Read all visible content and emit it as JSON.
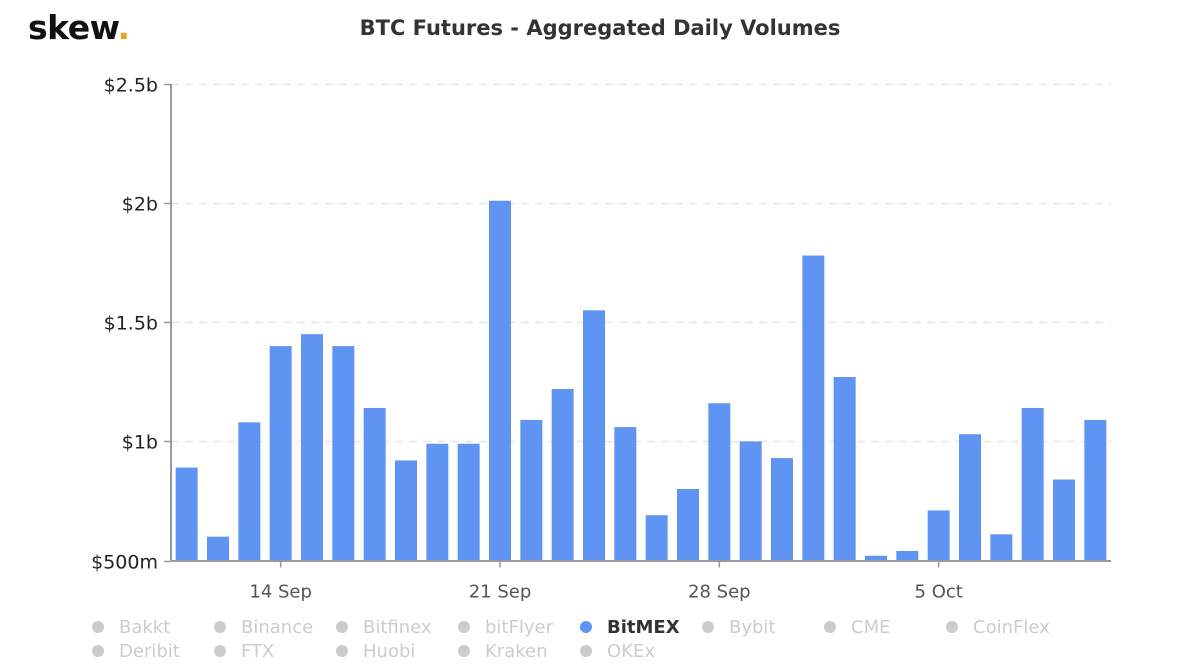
{
  "brand": {
    "name": "skew",
    "dot": ".",
    "dot_color": "#e9a829"
  },
  "chart_data": {
    "type": "bar",
    "title": "BTC Futures - Aggregated Daily Volumes",
    "xlabel": "",
    "ylabel": "",
    "unit": "USD billions",
    "ylim": [
      0.5,
      2.5
    ],
    "yticks": [
      {
        "value": 0.5,
        "label": "$500m"
      },
      {
        "value": 1.0,
        "label": "$1b"
      },
      {
        "value": 1.5,
        "label": "$1.5b"
      },
      {
        "value": 2.0,
        "label": "$2b"
      },
      {
        "value": 2.5,
        "label": "$2.5b"
      }
    ],
    "xticks": [
      {
        "category": "14 Sep",
        "label": "14 Sep"
      },
      {
        "category": "21 Sep",
        "label": "21 Sep"
      },
      {
        "category": "28 Sep",
        "label": "28 Sep"
      },
      {
        "category": "5 Oct",
        "label": "5 Oct"
      }
    ],
    "grid": true,
    "categories": [
      "11 Sep",
      "12 Sep",
      "13 Sep",
      "14 Sep",
      "15 Sep",
      "16 Sep",
      "17 Sep",
      "18 Sep",
      "19 Sep",
      "20 Sep",
      "21 Sep",
      "22 Sep",
      "23 Sep",
      "24 Sep",
      "25 Sep",
      "26 Sep",
      "27 Sep",
      "28 Sep",
      "29 Sep",
      "30 Sep",
      "1 Oct",
      "2 Oct",
      "3 Oct",
      "4 Oct",
      "5 Oct",
      "6 Oct",
      "7 Oct",
      "8 Oct",
      "9 Oct",
      "10 Oct"
    ],
    "series": [
      {
        "name": "BitMEX",
        "color": "#6094f3",
        "values": [
          0.89,
          0.6,
          1.08,
          1.4,
          1.45,
          1.4,
          1.14,
          0.92,
          0.99,
          0.99,
          2.01,
          1.09,
          1.22,
          1.55,
          1.06,
          0.69,
          0.8,
          1.16,
          1.0,
          0.93,
          1.78,
          1.27,
          0.52,
          0.54,
          0.71,
          1.03,
          0.61,
          1.14,
          0.84,
          1.09
        ]
      }
    ],
    "legend": {
      "placement": "bottom",
      "items": [
        {
          "label": "Bakkt",
          "active": false
        },
        {
          "label": "Binance",
          "active": false
        },
        {
          "label": "Bitfinex",
          "active": false
        },
        {
          "label": "bitFlyer",
          "active": false
        },
        {
          "label": "BitMEX",
          "active": true
        },
        {
          "label": "Bybit",
          "active": false
        },
        {
          "label": "CME",
          "active": false
        },
        {
          "label": "CoinFlex",
          "active": false
        },
        {
          "label": "Deribit",
          "active": false
        },
        {
          "label": "FTX",
          "active": false
        },
        {
          "label": "Huobi",
          "active": false
        },
        {
          "label": "Kraken",
          "active": false
        },
        {
          "label": "OKEx",
          "active": false
        }
      ],
      "active_color": "#6094f3",
      "inactive_color": "#cccccc"
    }
  }
}
